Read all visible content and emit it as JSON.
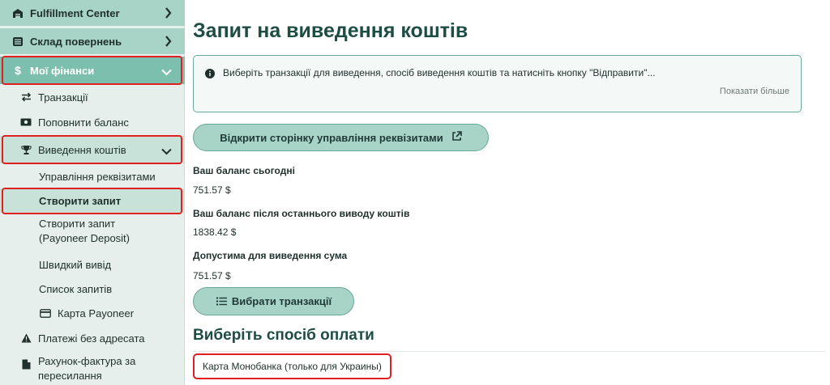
{
  "sidebar": {
    "fulfillment": "Fulfillment Center",
    "returns": "Склад повернень",
    "finances": "Мої фінанси",
    "finances_currency_icon": "$",
    "transactions": "Транзакції",
    "topup": "Поповнити баланс",
    "withdrawal": "Виведення коштів",
    "manage_requisites": "Управління реквізитами",
    "create_request": "Створити запит",
    "create_request_payoneer": "Створити запит (Payoneer Deposit)",
    "quick_withdrawal": "Швидкий вивід",
    "requests_list": "Список запитів",
    "payoneer_card": "Карта Payoneer",
    "unassigned_payments": "Платежі без адресата",
    "invoice": "Рахунок-фактура за пересилання"
  },
  "main": {
    "title": "Запит на виведення коштів",
    "info_text": "Виберіть транзакції для виведення, спосіб виведення коштів та натисніть кнопку \"Відправити\"...",
    "info_more": "Показати більше",
    "open_requisites_button": "Відкрити сторінку управління реквізитами",
    "balance_today_label": "Ваш баланс сьогодні",
    "balance_today_value": "751.57 $",
    "balance_after_label": "Ваш баланс після останнього виводу коштів",
    "balance_after_value": "1838.42 $",
    "allowed_label": "Допустима для виведення сума",
    "allowed_value": "751.57 $",
    "select_tx_button": "Вибрати транзакції",
    "payment_method_title": "Виберіть спосіб оплати",
    "payment_option": "Карта Монобанка (только для Украины)"
  },
  "colors": {
    "accent": "#a8d3c7",
    "accent_border": "#6aa899",
    "active": "#7dbfae",
    "highlight": "#e02020",
    "title": "#1e4d44"
  }
}
